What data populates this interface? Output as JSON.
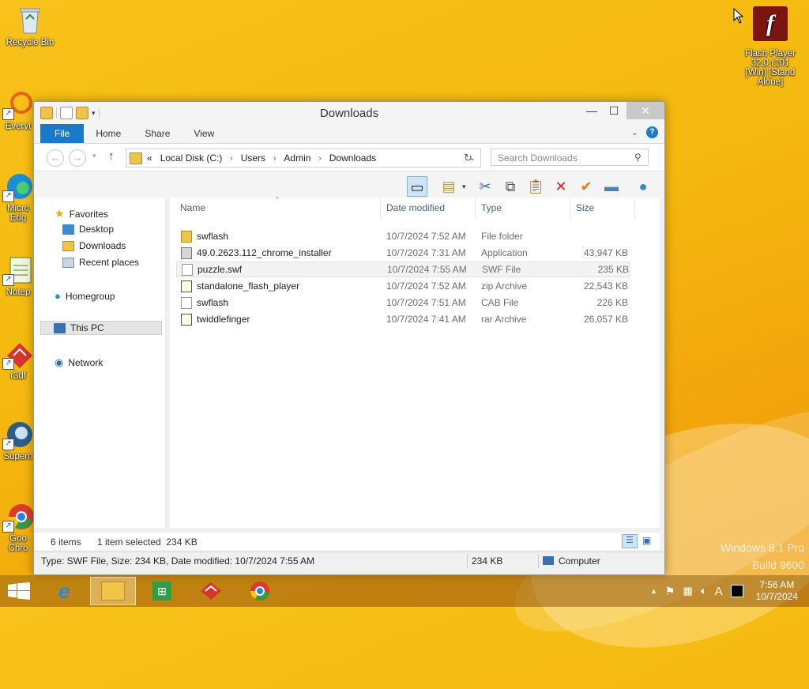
{
  "desktop": {
    "icons": [
      {
        "label": "Recycle Bin"
      },
      {
        "label": "Everyt"
      },
      {
        "label": "Micro Edg"
      },
      {
        "label": "Notep"
      },
      {
        "label": "r3df"
      },
      {
        "label": "Supern"
      },
      {
        "label": "Goo Chro"
      }
    ],
    "flash_icon": {
      "label": "Flash Player 32.0 r101 [Win] [Stand Alone]"
    },
    "watermark": {
      "line1": "Windows 8.1 Pro",
      "line2": "Build 9600"
    }
  },
  "window": {
    "title": "Downloads",
    "controls": {
      "minimize": "—",
      "maximize": "☐",
      "close": "✕"
    },
    "ribbon_tabs": [
      "File",
      "Home",
      "Share",
      "View"
    ],
    "address": {
      "prefix": "«",
      "segments": [
        "Local Disk (C:)",
        "Users",
        "Admin",
        "Downloads"
      ]
    },
    "search_placeholder": "Search Downloads",
    "nav": {
      "favorites": "Favorites",
      "favorite_items": [
        "Desktop",
        "Downloads",
        "Recent places"
      ],
      "homegroup": "Homegroup",
      "this_pc": "This PC",
      "network": "Network"
    },
    "columns": {
      "name": "Name",
      "date": "Date modified",
      "type": "Type",
      "size": "Size"
    },
    "files": [
      {
        "name": "swflash",
        "date": "10/7/2024 7:52 AM",
        "type": "File folder",
        "size": "",
        "icon": "folder-icon"
      },
      {
        "name": "49.0.2623.112_chrome_installer",
        "date": "10/7/2024 7:31 AM",
        "type": "Application",
        "size": "43,947 KB",
        "icon": "application-icon"
      },
      {
        "name": "puzzle.swf",
        "date": "10/7/2024 7:55 AM",
        "type": "SWF File",
        "size": "235 KB",
        "icon": "swf-file-icon"
      },
      {
        "name": "standalone_flash_player",
        "date": "10/7/2024 7:52 AM",
        "type": "zip Archive",
        "size": "22,543 KB",
        "icon": "zip-archive-icon"
      },
      {
        "name": "swflash",
        "date": "10/7/2024 7:51 AM",
        "type": "CAB File",
        "size": "226 KB",
        "icon": "cab-file-icon"
      },
      {
        "name": "twiddlefinger",
        "date": "10/7/2024 7:41 AM",
        "type": "rar Archive",
        "size": "26,057 KB",
        "icon": "rar-archive-icon"
      }
    ],
    "status": {
      "items": "6 items",
      "selected": "1 item selected  234 KB"
    },
    "details": {
      "info": "Type: SWF File, Size: 234 KB, Date modified: 10/7/2024 7:55 AM",
      "size": "234 KB",
      "location": "Computer"
    }
  },
  "taskbar": {
    "clock_time": "7:56 AM",
    "clock_date": "10/7/2024",
    "tray_lang": "A"
  },
  "colors": {
    "accent": "#1979ca",
    "desktop": "#f5b90f"
  }
}
